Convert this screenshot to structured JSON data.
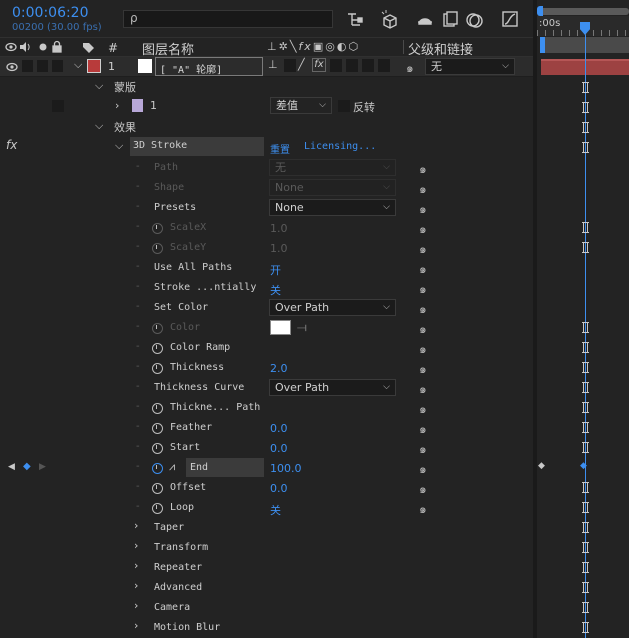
{
  "toolbar": {
    "timecode": "0:00:06:20",
    "frame_fps": "00200 (30.00 fps)",
    "search_placeholder": "ρ"
  },
  "columns": {
    "hash": "#",
    "layer_name": "图层名称",
    "parent_link": "父级和链接"
  },
  "layer": {
    "number": "1",
    "name": "[ \"A\" 轮廓]",
    "parent_value": "无"
  },
  "mask_section": {
    "label": "蒙版",
    "mask_number": "1",
    "mode": "差值",
    "invert_label": "反转"
  },
  "effects_section": {
    "label": "效果"
  },
  "effect": {
    "fx_label": "fx",
    "name": "3D Stroke",
    "reset_label": "重置",
    "licensing_label": "Licensing..."
  },
  "properties": [
    {
      "label": "Path",
      "value": "无",
      "kind": "dropdown",
      "disabled": true
    },
    {
      "label": "Shape",
      "value": "None",
      "kind": "dropdown",
      "disabled": true
    },
    {
      "label": "Presets",
      "value": "None",
      "kind": "dropdown",
      "disabled": false
    },
    {
      "label": "ScaleX",
      "value": "1.0",
      "kind": "value",
      "disabled": true
    },
    {
      "label": "ScaleY",
      "value": "1.0",
      "kind": "value",
      "disabled": true
    },
    {
      "label": "Use All Paths",
      "value": "开",
      "kind": "value",
      "disabled": false
    },
    {
      "label": "Stroke ...ntially",
      "value": "关",
      "kind": "value",
      "disabled": false
    },
    {
      "label": "Set Color",
      "value": "Over Path",
      "kind": "dropdown",
      "disabled": false
    },
    {
      "label": "Color",
      "value": "",
      "kind": "color",
      "disabled": true
    },
    {
      "label": "Color Ramp",
      "value": "",
      "kind": "none",
      "disabled": false
    },
    {
      "label": "Thickness",
      "value": "2.0",
      "kind": "value",
      "disabled": false
    },
    {
      "label": "Thickness Curve",
      "value": "Over Path",
      "kind": "dropdown",
      "disabled": false
    },
    {
      "label": "Thickne... Path",
      "value": "",
      "kind": "none",
      "disabled": false
    },
    {
      "label": "Feather",
      "value": "0.0",
      "kind": "value",
      "disabled": false
    },
    {
      "label": "Start",
      "value": "0.0",
      "kind": "value",
      "disabled": false
    },
    {
      "label": "End",
      "value": "100.0",
      "kind": "value",
      "disabled": false
    },
    {
      "label": "Offset",
      "value": "0.0",
      "kind": "value",
      "disabled": false
    },
    {
      "label": "Loop",
      "value": "关",
      "kind": "value",
      "disabled": false
    }
  ],
  "groups": [
    "Taper",
    "Transform",
    "Repeater",
    "Advanced",
    "Camera",
    "Motion Blur"
  ],
  "timeline": {
    "start_label": ":00s"
  },
  "colors": {
    "accent": "#3d8ff0",
    "layer_label": "#b83b3b",
    "track_bar": "#b34848"
  }
}
